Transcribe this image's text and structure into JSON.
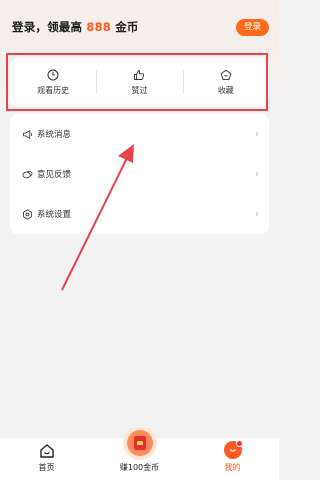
{
  "header": {
    "login_prefix": "登录，领最高 ",
    "coin_amount": "888",
    "login_suffix": " 金币",
    "login_button": "登录"
  },
  "history_card": {
    "items": [
      {
        "label": "观看历史",
        "icon": "clock-icon"
      },
      {
        "label": "赞过",
        "icon": "thumbs-up-icon"
      },
      {
        "label": "收藏",
        "icon": "star-icon"
      }
    ]
  },
  "menu": {
    "items": [
      {
        "label": "系统消息",
        "icon": "megaphone-icon"
      },
      {
        "label": "意见反馈",
        "icon": "feedback-icon"
      },
      {
        "label": "系统设置",
        "icon": "gear-icon"
      }
    ]
  },
  "bottom_nav": {
    "items": [
      {
        "label": "首页",
        "icon": "home-icon"
      },
      {
        "label": "赚100金币",
        "icon": "red-envelope-icon"
      },
      {
        "label": "我的",
        "icon": "me-icon"
      }
    ]
  },
  "colors": {
    "accent": "#ff5a1f",
    "highlight": "#e8424a"
  }
}
